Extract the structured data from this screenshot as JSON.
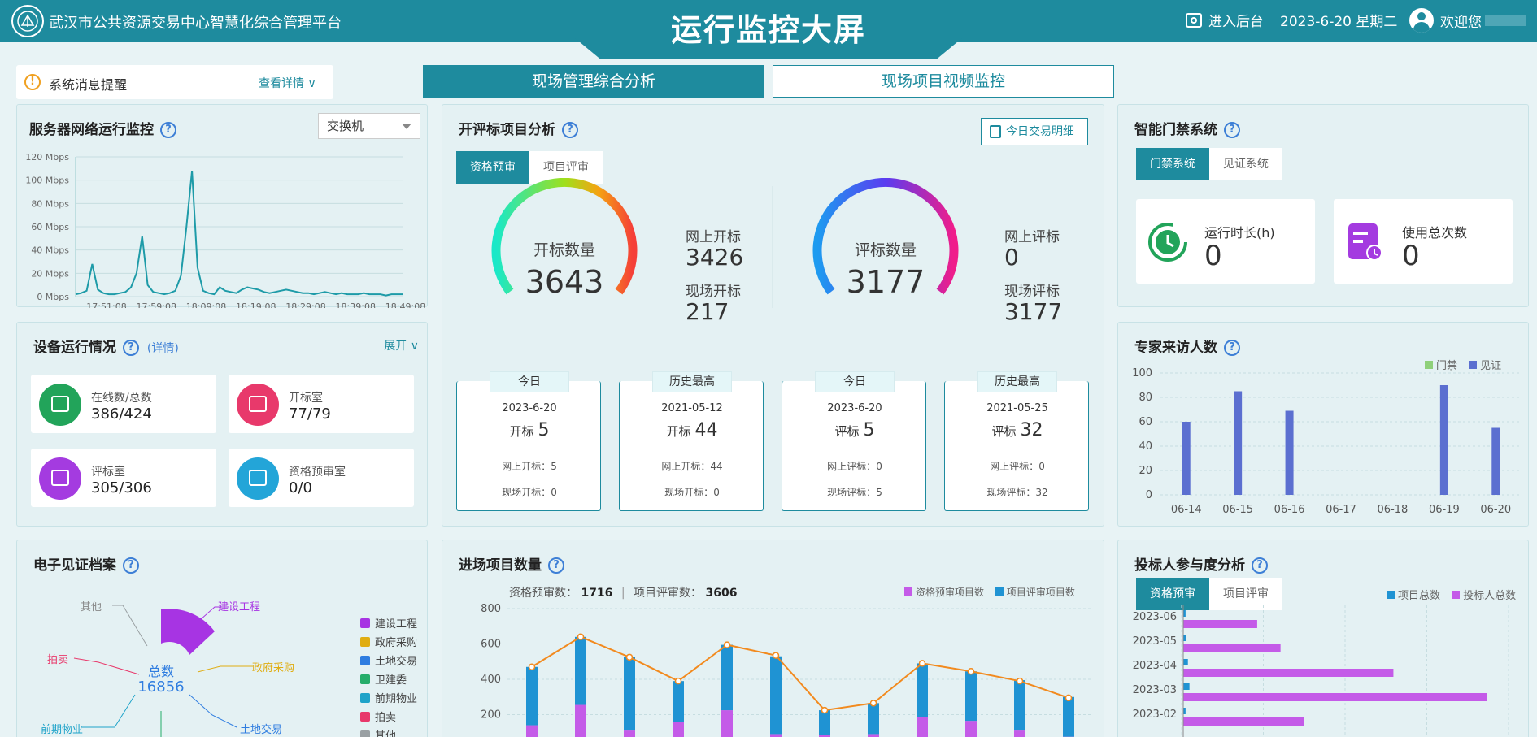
{
  "header": {
    "org_name": "武汉市公共资源交易中心智慧化综合管理平台",
    "title": "运行监控大屏",
    "backend_label": "进入后台",
    "date": "2023-6-20 星期二",
    "welcome": "欢迎您"
  },
  "notice": {
    "label": "系统消息提醒",
    "detail_label": "查看详情"
  },
  "nav_tabs": [
    {
      "label": "现场管理综合分析"
    },
    {
      "label": "现场项目视频监控"
    }
  ],
  "server_monitor": {
    "title": "服务器网络运行监控",
    "select_value": "交换机",
    "chart_data": {
      "type": "line",
      "y_ticks": [
        "120 Mbps",
        "100 Mbps",
        "80 Mbps",
        "60 Mbps",
        "40 Mbps",
        "20 Mbps",
        "0 Mbps"
      ],
      "x_ticks": [
        "17:51:08",
        "17:59:08",
        "18:09:08",
        "18:19:08",
        "18:29:08",
        "18:39:08",
        "18:49:08"
      ],
      "ylim": [
        0,
        120
      ],
      "values": [
        2,
        3,
        5,
        28,
        6,
        3,
        2,
        2,
        3,
        4,
        8,
        20,
        52,
        10,
        4,
        3,
        2,
        3,
        5,
        18,
        60,
        108,
        25,
        5,
        3,
        2,
        8,
        5,
        4,
        3,
        6,
        8,
        7,
        6,
        4,
        3,
        4,
        5,
        6,
        5,
        4,
        3,
        3,
        2,
        3,
        4,
        3,
        2,
        3,
        2,
        2,
        2,
        3,
        2,
        2,
        2,
        1,
        2,
        2,
        2
      ]
    }
  },
  "devices": {
    "title": "设备运行情况",
    "detail_label": "(详情)",
    "expand_label": "展开",
    "items": [
      {
        "label": "在线数/总数",
        "value": "386/424",
        "color": "#22a45a",
        "icon": "monitor-icon"
      },
      {
        "label": "开标室",
        "value": "77/79",
        "color": "#e8396b",
        "icon": "document-icon"
      },
      {
        "label": "评标室",
        "value": "305/306",
        "color": "#a43be0",
        "icon": "edit-icon"
      },
      {
        "label": "资格预审室",
        "value": "0/0",
        "color": "#23a5d8",
        "icon": "inbox-icon"
      }
    ]
  },
  "archive": {
    "title": "电子见证档案",
    "total_label": "总数",
    "total_value": "16856",
    "chart_data": {
      "type": "pie",
      "labels": [
        "建设工程",
        "政府采购",
        "土地交易",
        "卫建委",
        "前期物业",
        "拍卖",
        "其他"
      ],
      "colors": [
        "#a734e3",
        "#e0ad12",
        "#2f7de0",
        "#25ad6a",
        "#1ea3c9",
        "#e8396b",
        "#9aa0a3"
      ],
      "legend_position": "right"
    }
  },
  "bid_analysis": {
    "title": "开评标项目分析",
    "detail_btn": "今日交易明细",
    "tabs": [
      "资格预审",
      "项目评审"
    ],
    "gauge1": {
      "label": "开标数量",
      "value": "3643",
      "online_label": "网上开标",
      "online_value": "3426",
      "onsite_label": "现场开标",
      "onsite_value": "217"
    },
    "gauge2": {
      "label": "评标数量",
      "value": "3177",
      "online_label": "网上评标",
      "online_value": "0",
      "onsite_label": "现场评标",
      "onsite_value": "3177"
    },
    "stats": [
      {
        "head": "今日",
        "date": "2023-6-20",
        "kind": "开标",
        "num": "5",
        "l1": "网上开标：",
        "v1": "5",
        "l2": "现场开标：",
        "v2": "0"
      },
      {
        "head": "历史最高",
        "date": "2021-05-12",
        "kind": "开标",
        "num": "44",
        "l1": "网上开标：",
        "v1": "44",
        "l2": "现场开标：",
        "v2": "0"
      },
      {
        "head": "今日",
        "date": "2023-6-20",
        "kind": "评标",
        "num": "5",
        "l1": "网上评标：",
        "v1": "0",
        "l2": "现场评标：",
        "v2": "5"
      },
      {
        "head": "历史最高",
        "date": "2021-05-25",
        "kind": "评标",
        "num": "32",
        "l1": "网上评标：",
        "v1": "0",
        "l2": "现场评标：",
        "v2": "32"
      }
    ]
  },
  "entry_projects": {
    "title": "进场项目数量",
    "qual_label": "资格预审数：",
    "qual_value": "1716",
    "review_label": "项目评审数：",
    "review_value": "3606",
    "chart_data": {
      "type": "bar",
      "y_ticks": [
        "800",
        "600",
        "400",
        "200",
        "0"
      ],
      "ylim": [
        0,
        800
      ],
      "series": [
        {
          "name": "资格预审项目数",
          "color": "#c45be8",
          "values": [
            140,
            255,
            110,
            160,
            225,
            90,
            85,
            90,
            185,
            165,
            110,
            75
          ]
        },
        {
          "name": "项目评审项目数",
          "color": "#1f93d3",
          "values": [
            330,
            385,
            415,
            230,
            370,
            440,
            140,
            175,
            305,
            280,
            285,
            225
          ]
        }
      ],
      "line": [
        470,
        640,
        525,
        390,
        595,
        535,
        225,
        265,
        490,
        445,
        390,
        295
      ],
      "line_color": "#f28a1e"
    }
  },
  "access": {
    "title": "智能门禁系统",
    "tabs": [
      "门禁系统",
      "见证系统"
    ],
    "cards": [
      {
        "label": "运行时长(h)",
        "value": "0"
      },
      {
        "label": "使用总次数",
        "value": "0"
      }
    ]
  },
  "experts": {
    "title": "专家来访人数",
    "chart_data": {
      "type": "bar",
      "categories": [
        "06-14",
        "06-15",
        "06-16",
        "06-17",
        "06-18",
        "06-19",
        "06-20"
      ],
      "y_ticks": [
        "100",
        "80",
        "60",
        "40",
        "20",
        "0"
      ],
      "ylim": [
        0,
        100
      ],
      "series": [
        {
          "name": "门禁",
          "color": "#8fd07a",
          "values": [
            0,
            0,
            0,
            0,
            0,
            0,
            0
          ]
        },
        {
          "name": "见证",
          "color": "#5b6fd0",
          "values": [
            60,
            85,
            69,
            0,
            0,
            90,
            55
          ]
        }
      ],
      "legend_position": "top-right"
    }
  },
  "bidders": {
    "title": "投标人参与度分析",
    "tabs": [
      "资格预审",
      "项目评审"
    ],
    "chart_data": {
      "type": "bar",
      "categories": [
        "2023-06",
        "2023-05",
        "2023-04",
        "2023-03",
        "2023-02"
      ],
      "series": [
        {
          "name": "项目总数",
          "color": "#1f93d3",
          "values": [
            3,
            4,
            6,
            8,
            3
          ]
        },
        {
          "name": "投标人总数",
          "color": "#c45be8",
          "values": [
            95,
            125,
            270,
            390,
            155
          ]
        }
      ],
      "xlim": [
        0,
        420
      ],
      "legend_position": "top-right"
    }
  }
}
